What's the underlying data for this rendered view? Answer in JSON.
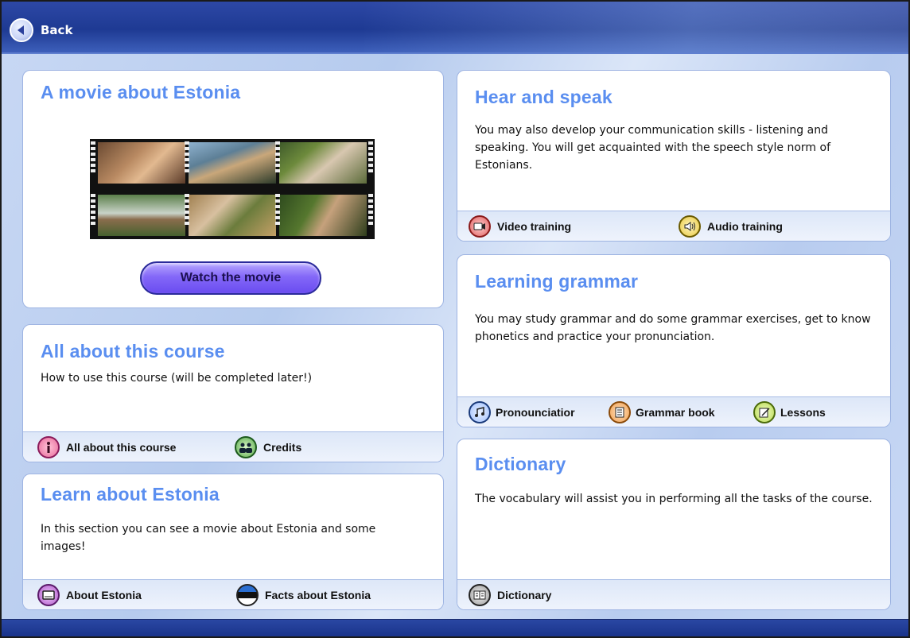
{
  "topbar": {
    "back_label": "Back"
  },
  "movie_panel": {
    "title": "A movie about Estonia",
    "watch_button": "Watch the movie"
  },
  "about_course_panel": {
    "title": "All about this course",
    "text": "How to use this course (will be completed later!)",
    "links": [
      {
        "label": "All about this course",
        "icon": "info-icon"
      },
      {
        "label": "Credits",
        "icon": "people-icon"
      }
    ]
  },
  "learn_estonia_panel": {
    "title": "Learn about Estonia",
    "text": "In this section you can see a movie about Estonia and some images!",
    "links": [
      {
        "label": "About Estonia",
        "icon": "book-icon"
      },
      {
        "label": "Facts about Estonia",
        "icon": "flag-icon"
      }
    ]
  },
  "hear_speak_panel": {
    "title": "Hear and speak",
    "text": "You may also develop your communication skills - listening and speaking. You will get acquainted with the speech style norm of Estonians.",
    "links": [
      {
        "label": "Video training",
        "icon": "video-camera-icon"
      },
      {
        "label": "Audio training",
        "icon": "speaker-icon"
      }
    ]
  },
  "grammar_panel": {
    "title": "Learning grammar",
    "text": "You may study grammar and do some grammar exercises, get to know phonetics and practice your pronunciation.",
    "links": [
      {
        "label": "Pronounciatior",
        "icon": "music-note-icon"
      },
      {
        "label": "Grammar book",
        "icon": "document-icon"
      },
      {
        "label": "Lessons",
        "icon": "pencil-note-icon"
      }
    ]
  },
  "dictionary_panel": {
    "title": "Dictionary",
    "text": "The vocabulary will assist you in performing all the tasks of the course.",
    "links": [
      {
        "label": "Dictionary",
        "icon": "open-book-icon"
      }
    ]
  },
  "colors": {
    "title_blue": "#5a8ef0",
    "topbar_blue": "#1e3a93",
    "button_purple": "#7a5cf5"
  }
}
